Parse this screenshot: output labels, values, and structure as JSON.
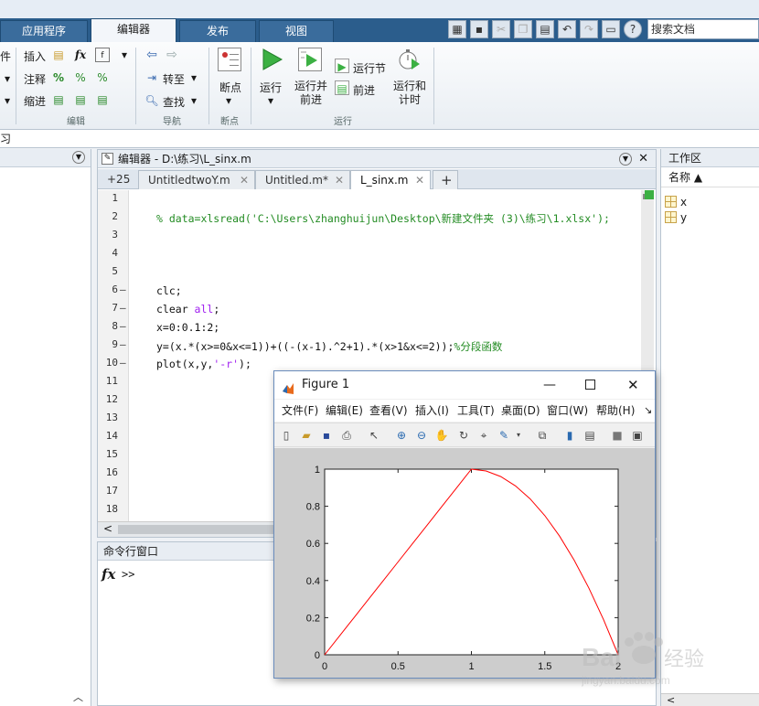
{
  "topbar": {
    "tabs": [
      "应用程序",
      "编辑器",
      "发布",
      "视图"
    ],
    "active_tab": "编辑器",
    "search_placeholder": "搜索文档"
  },
  "ribbon": {
    "left_partial_label": "件",
    "insert_label": "插入",
    "comment_label": "注释",
    "indent_label": "缩进",
    "fx_label": "fx",
    "goto_label": "转至",
    "find_label": "查找",
    "breakpoint_label": "断点",
    "run_label": "运行",
    "run_advance_label": "运行并\n前进",
    "run_section_label": "运行节",
    "advance_label": "前进",
    "run_time_label": "运行和\n计时",
    "sections": {
      "edit": "编辑",
      "nav": "导航",
      "breakpoints": "断点",
      "run": "运行"
    }
  },
  "address": "习",
  "editor": {
    "title": "编辑器 - D:\\练习\\L_sinx.m",
    "tabs": [
      {
        "label": "+25"
      },
      {
        "label": "UntitledtwoY.m"
      },
      {
        "label": "Untitled.m*"
      },
      {
        "label": "L_sinx.m"
      }
    ],
    "add_tab": "+",
    "line_numbers": [
      "1",
      "2",
      "3",
      "4",
      "5",
      "6",
      "7",
      "8",
      "9",
      "10",
      "11",
      "12",
      "13",
      "14",
      "15",
      "16",
      "17",
      "18"
    ],
    "code_lines": {
      "l2": "% data=xlsread('C:\\Users\\zhanghuijun\\Desktop\\新建文件夹 (3)\\练习\\1.xlsx');",
      "l6": "clc;",
      "l7_a": "clear ",
      "l7_b": "all",
      "l7_c": ";",
      "l8": "x=0:0.1:2;",
      "l9_a": "y=(x.*(x>=0&x<=1))+((-(x-1).^2+1).*(x>1&x<=2));",
      "l9_b": "%分段函数",
      "l10_a": "plot(x,y,",
      "l10_b": "'-r'",
      "l10_c": ");"
    },
    "dash": "–",
    "scroll_left": "<"
  },
  "command_window": {
    "title": "命令行窗口",
    "fx": "fx",
    "prompt": ">>"
  },
  "workspace": {
    "title": "工作区",
    "column": "名称 ▲",
    "vars": [
      "x",
      "y"
    ]
  },
  "figure": {
    "title": "Figure 1",
    "menu": [
      "文件(F)",
      "编辑(E)",
      "查看(V)",
      "插入(I)",
      "工具(T)",
      "桌面(D)",
      "窗口(W)",
      "帮助(H)"
    ],
    "menu_more": "↘"
  },
  "chart_data": {
    "type": "line",
    "title": "",
    "xlabel": "",
    "ylabel": "",
    "xlim": [
      0,
      2
    ],
    "ylim": [
      0,
      1
    ],
    "xticks": [
      "0",
      "0.5",
      "1",
      "1.5",
      "2"
    ],
    "yticks": [
      "0",
      "0.2",
      "0.4",
      "0.6",
      "0.8",
      "1"
    ],
    "series": [
      {
        "color": "#ff0000",
        "x": [
          0,
          0.1,
          0.2,
          0.3,
          0.4,
          0.5,
          0.6,
          0.7,
          0.8,
          0.9,
          1.0,
          1.1,
          1.2,
          1.3,
          1.4,
          1.5,
          1.6,
          1.7,
          1.8,
          1.9,
          2.0
        ],
        "y": [
          0,
          0.1,
          0.2,
          0.3,
          0.4,
          0.5,
          0.6,
          0.7,
          0.8,
          0.9,
          1.0,
          0.99,
          0.96,
          0.91,
          0.84,
          0.75,
          0.64,
          0.51,
          0.36,
          0.19,
          0
        ]
      }
    ]
  },
  "watermark": {
    "brand": "Bai",
    "cn": "经验",
    "url": "jingyan.baidu.com"
  },
  "colors": {
    "topbar_blue": "#2b5d8c",
    "comment_green": "#228b22",
    "keyword_purple": "#a020f0",
    "plot_line": "#ff0000"
  }
}
